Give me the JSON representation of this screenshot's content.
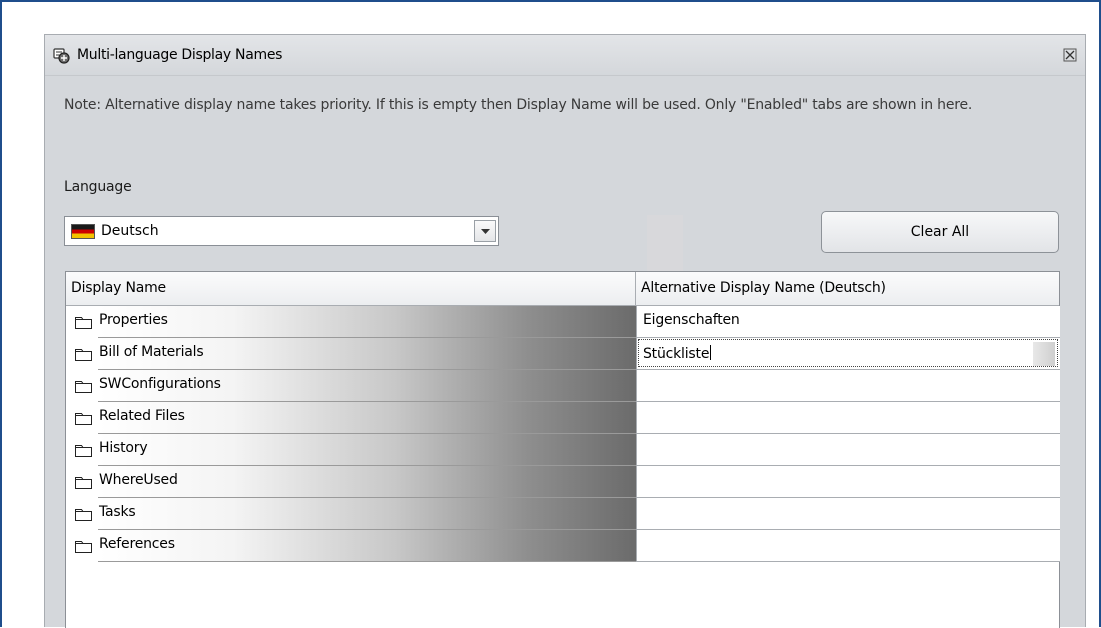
{
  "dialog": {
    "title": "Multi-language Display Names",
    "note": "Note: Alternative display name takes priority. If this is empty then Display Name will be used. Only \"Enabled\" tabs are shown in here.",
    "language_label": "Language",
    "language_selected": "Deutsch",
    "clear_all_label": "Clear All"
  },
  "grid": {
    "columns": [
      "Display Name",
      "Alternative Display Name  (Deutsch)"
    ],
    "rows": [
      {
        "name": "Properties",
        "alt": "Eigenschaften"
      },
      {
        "name": "Bill of Materials",
        "alt": "Stückliste"
      },
      {
        "name": "SWConfigurations",
        "alt": ""
      },
      {
        "name": "Related Files",
        "alt": ""
      },
      {
        "name": "History",
        "alt": ""
      },
      {
        "name": "WhereUsed",
        "alt": ""
      },
      {
        "name": "Tasks",
        "alt": ""
      },
      {
        "name": "References",
        "alt": ""
      }
    ]
  },
  "icons": {
    "app": "multi-language-icon",
    "close": "close-icon",
    "flag": "german-flag-icon",
    "dropdown": "chevron-down-icon",
    "folder": "folder-icon"
  },
  "colors": {
    "frame": "#1f4e8c",
    "dialog_bg": "#d4d7db"
  }
}
